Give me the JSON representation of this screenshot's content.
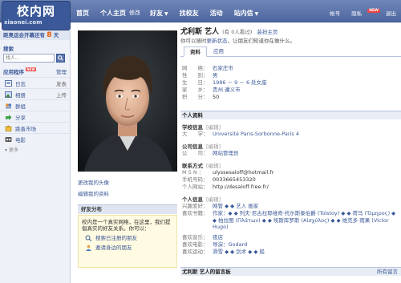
{
  "logo": {
    "main": "校内网",
    "sub": "xiaonei.com"
  },
  "nav": {
    "items": [
      "首页",
      "个人主页",
      "修改",
      "好友",
      "找校友",
      "活动",
      "站内信"
    ],
    "right": {
      "account": "帐号",
      "privacy": "隐私",
      "new_badge": "NEW",
      "logout": "退出"
    }
  },
  "sidebar": {
    "olympic": {
      "text": "距奥运会开幕还有",
      "days": "8",
      "unit": "天"
    },
    "search_label": "搜索",
    "search_placeholder": "找人...",
    "apps_title": "应用程序",
    "apps_new": "NEW",
    "apps_manage": "管理",
    "apps": [
      {
        "name": "日志",
        "action": "发表",
        "icon": "journal-icon"
      },
      {
        "name": "相册",
        "action": "上传",
        "icon": "album-icon"
      },
      {
        "name": "群组",
        "action": "",
        "icon": "group-icon"
      },
      {
        "name": "分享",
        "action": "",
        "icon": "share-icon"
      },
      {
        "name": "跳蚤市场",
        "action": "",
        "icon": "market-icon"
      },
      {
        "name": "电影",
        "action": "",
        "icon": "movie-icon"
      }
    ],
    "more": "更多"
  },
  "photo": {
    "change_avatar": "更改我的头像",
    "edit_profile": "编辑我的资料"
  },
  "friend_dist": {
    "title": "好友分布",
    "text": "校内是一个真实网络，在这里，我们提倡真实的好友关系。你可以：",
    "actions": [
      "搜索已注册的朋友",
      "邀请身边的朋友"
    ]
  },
  "profile": {
    "name": "尤利斯 艺人",
    "visits": "(有 0人看过)",
    "back_home": "装扮主页",
    "intro_prefix": "你可以随时",
    "intro_link": "更新状态",
    "intro_suffix": "，让朋友们知道你在做什么。",
    "tabs": [
      "资料",
      "应用"
    ],
    "basic": [
      {
        "k": "网　　络：",
        "v": "石家庄市"
      },
      {
        "k": "性　　别：",
        "v": "男"
      },
      {
        "k": "生　　日：",
        "v": "1986 － 9 － 6 处女座"
      },
      {
        "k": "家　　乡：",
        "v": "贵州 遵义市"
      },
      {
        "k": "积　　分：",
        "v": "50",
        "plain": true
      }
    ],
    "section_profile": "个人资料",
    "edit": "[编辑]",
    "school_title": "学校信息",
    "school": {
      "k": "大　　学：",
      "v": "Université Paris-Sorbonne-Paris 4"
    },
    "company_title": "公司信息",
    "company": {
      "k": "公　　司：",
      "v": "网站管理员"
    },
    "contact_title": "联系方式",
    "contact": [
      {
        "k": "M S N ：",
        "v": "ulyssesaloff@hotmail.fr",
        "plain": true
      },
      {
        "k": "手机号码：",
        "v": "0033665453320",
        "plain": true
      },
      {
        "k": "个人网站：",
        "v": "http://desaloff.free.fr/",
        "plain": true
      }
    ],
    "personal_title": "个人信息",
    "personal": [
      {
        "k": "兴趣爱好：",
        "v": "网管 ◆ ◆ 艺人 画家"
      },
      {
        "k": "喜欢书籍：",
        "v": "作家：◆ ◆ 列夫·尼古拉耶维奇·托尔斯泰伯爵 (Tolstoy) ◆ ◆ 荷马 (Ὅμηρος) ◆ ◆ 柏拉图 (Πλάτων) ◆ ◆ 埃斯库罗斯 (Αἰσχύλος) ◆ ◆ 维克多·雨果 (Victor Hugo)"
      },
      {
        "k": "喜欢音乐：",
        "v": "夜店"
      },
      {
        "k": "喜欢电影：",
        "v": "导演：Godard"
      },
      {
        "k": "喜欢运动：",
        "v": "滑雪 ◆ ◆ 剑术 ◆ ◆ 船"
      }
    ],
    "guestbook_title": "尤利斯 艺人的留言板",
    "guestbook_more": "所有留言"
  }
}
